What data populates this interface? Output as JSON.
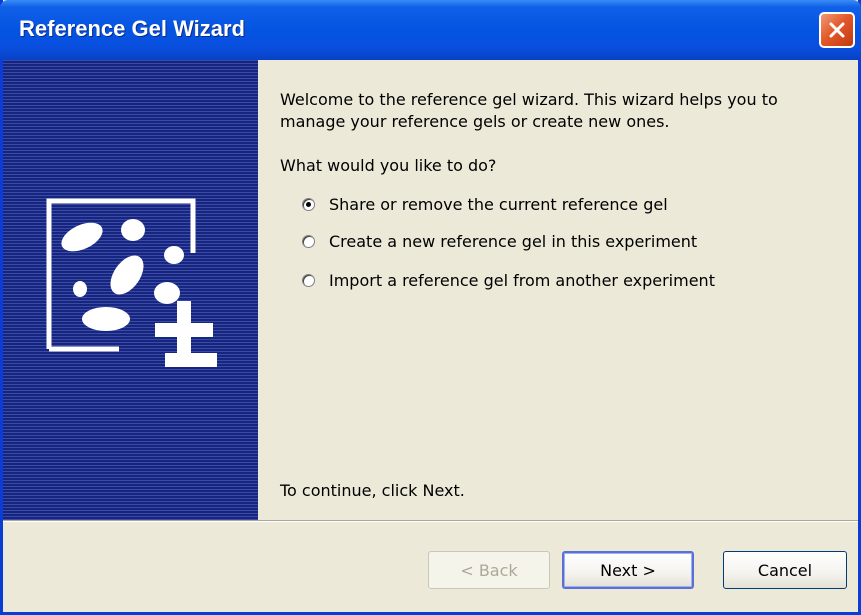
{
  "window": {
    "title": "Reference Gel Wizard",
    "close_icon": "close-icon"
  },
  "content": {
    "welcome": "Welcome to the reference gel wizard. This wizard helps you to manage your reference gels or create new ones.",
    "question": "What would you like to do?",
    "options": [
      {
        "label": "Share or remove the current reference gel",
        "checked": true
      },
      {
        "label": "Create a new reference gel in this experiment",
        "checked": false
      },
      {
        "label": "Import a reference gel from another experiment",
        "checked": false
      }
    ],
    "continue_hint": "To continue, click Next."
  },
  "buttons": {
    "back": "< Back",
    "next": "Next >",
    "cancel": "Cancel"
  },
  "colors": {
    "title_bar": "#0454e2",
    "side_panel": "#1c2e8a",
    "dialog_bg": "#ece9d8",
    "close_button": "#e25a2b"
  },
  "icons": {
    "wizard_graphic": "reference-gel-icon"
  }
}
